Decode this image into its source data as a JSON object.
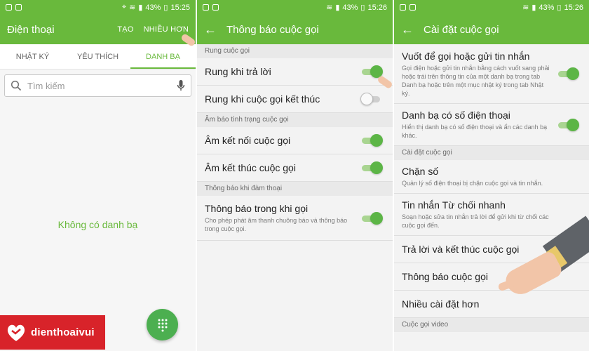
{
  "status": {
    "battery": "43%",
    "time": "15:25",
    "time2": "15:26"
  },
  "panel1": {
    "title": "Điện thoại",
    "action_create": "TẠO",
    "action_more": "NHIỀU HƠN",
    "tabs": [
      {
        "label": "NHẬT KÝ",
        "active": false
      },
      {
        "label": "YÊU THÍCH",
        "active": false
      },
      {
        "label": "DANH BẠ",
        "active": true
      }
    ],
    "search_placeholder": "Tìm kiếm",
    "empty_text": "Không có danh bạ",
    "logo_text": "dienthoaivui"
  },
  "panel2": {
    "title": "Thông báo cuộc gọi",
    "sections": [
      {
        "header": "Rung cuộc gọi"
      },
      {
        "header": "Âm báo tình trạng cuộc gọi"
      },
      {
        "header": "Thông báo khi đàm thoại"
      }
    ],
    "items": [
      {
        "title": "Rung khi trả lời",
        "on": true
      },
      {
        "title": "Rung khi cuộc gọi kết thúc",
        "on": false
      },
      {
        "title": "Âm kết nối cuộc gọi",
        "on": true
      },
      {
        "title": "Âm kết thúc cuộc gọi",
        "on": true
      },
      {
        "title": "Thông báo trong khi gọi",
        "subtitle": "Cho phép phát âm thanh chuông báo và thông báo trong cuộc gọi.",
        "on": true
      }
    ]
  },
  "panel3": {
    "title": "Cài đặt cuộc gọi",
    "items": [
      {
        "title": "Vuốt để gọi hoặc gửi tin nhắn",
        "subtitle": "Gọi điện hoặc gửi tin nhắn bằng cách vuốt sang phải hoặc trái trên thông tin của một danh bạ trong tab Danh bạ hoặc trên một mục nhật ký trong tab Nhật ký.",
        "on": true
      },
      {
        "title": "Danh bạ có số điện thoại",
        "subtitle": "Hiển thị danh bạ có số điện thoại và ẩn các danh bạ khác.",
        "on": true
      },
      {
        "title": "Chặn số",
        "subtitle": "Quản lý số điện thoại bị chặn cuộc gọi và tin nhắn."
      },
      {
        "title": "Tin nhắn Từ chối nhanh",
        "subtitle": "Soạn hoặc sửa tin nhắn trả lời để gửi khi từ chối các cuộc gọi đến."
      },
      {
        "title": "Trả lời và kết thúc cuộc gọi"
      },
      {
        "title": "Thông báo cuộc gọi"
      },
      {
        "title": "Nhiều cài đặt hơn"
      }
    ],
    "section_call_settings": "Cài đặt cuộc gọi",
    "section_video": "Cuộc gọi video"
  }
}
